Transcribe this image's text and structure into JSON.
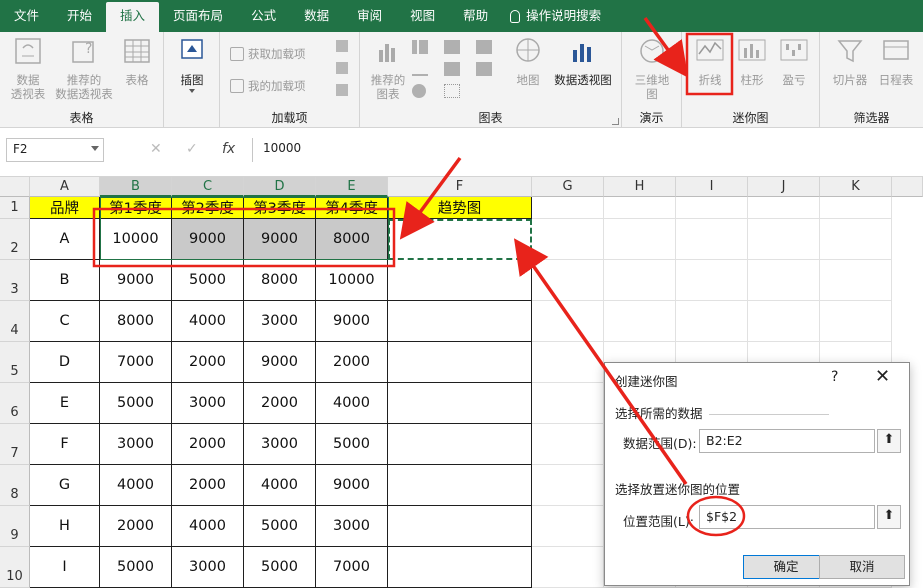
{
  "ribbon_tabs": [
    "文件",
    "开始",
    "插入",
    "页面布局",
    "公式",
    "数据",
    "审阅",
    "视图",
    "帮助",
    "操作说明搜索"
  ],
  "ribbon": {
    "tables": {
      "pivot": "数据\n透视表",
      "recommended_pivot": "推荐的\n数据透视表",
      "table": "表格",
      "label": "表格"
    },
    "illustrations": {
      "label": "插图"
    },
    "addins": {
      "get": "获取加载项",
      "mine": "我的加载项",
      "label": "加载项"
    },
    "charts": {
      "recommended": "推荐的\n图表",
      "map": "地图",
      "pivotchart": "数据透视图",
      "label": "图表"
    },
    "tours": {
      "map3d": "三维地\n图",
      "label": "演示"
    },
    "sparklines": {
      "line": "折线",
      "column": "柱形",
      "winloss": "盈亏",
      "label": "迷你图"
    },
    "filters": {
      "slicer": "切片器",
      "timeline": "日程表",
      "label": "筛选器"
    }
  },
  "formula_bar": {
    "name_box": "F2",
    "fx": "fx",
    "value": "10000"
  },
  "sheet": {
    "columns": [
      "A",
      "B",
      "C",
      "D",
      "E",
      "F",
      "G",
      "H",
      "I",
      "J",
      "K"
    ],
    "rows": [
      "1",
      "2",
      "3",
      "4",
      "5",
      "6",
      "7",
      "8",
      "9",
      "10"
    ],
    "header": [
      "品牌",
      "第1季度",
      "第2季度",
      "第3季度",
      "第4季度",
      "趋势图"
    ],
    "data": [
      [
        "A",
        "10000",
        "9000",
        "9000",
        "8000"
      ],
      [
        "B",
        "9000",
        "5000",
        "8000",
        "10000"
      ],
      [
        "C",
        "8000",
        "4000",
        "3000",
        "9000"
      ],
      [
        "D",
        "7000",
        "2000",
        "9000",
        "2000"
      ],
      [
        "E",
        "5000",
        "3000",
        "2000",
        "4000"
      ],
      [
        "F",
        "3000",
        "2000",
        "3000",
        "5000"
      ],
      [
        "G",
        "4000",
        "2000",
        "4000",
        "9000"
      ],
      [
        "H",
        "2000",
        "4000",
        "5000",
        "3000"
      ],
      [
        "I",
        "5000",
        "3000",
        "5000",
        "7000"
      ]
    ]
  },
  "dialog": {
    "title": "创建迷你图",
    "help": "?",
    "close": "✕",
    "section_data": "选择所需的数据",
    "data_range_label": "数据范围(D):",
    "data_range_value": "B2:E2",
    "section_location": "选择放置迷你图的位置",
    "location_label": "位置范围(L):",
    "location_value": "$F$2",
    "ok": "确定",
    "cancel": "取消"
  },
  "colors": {
    "excel_green": "#217346",
    "highlight_yellow": "#ffff00",
    "annotation_red": "#e8231b"
  }
}
